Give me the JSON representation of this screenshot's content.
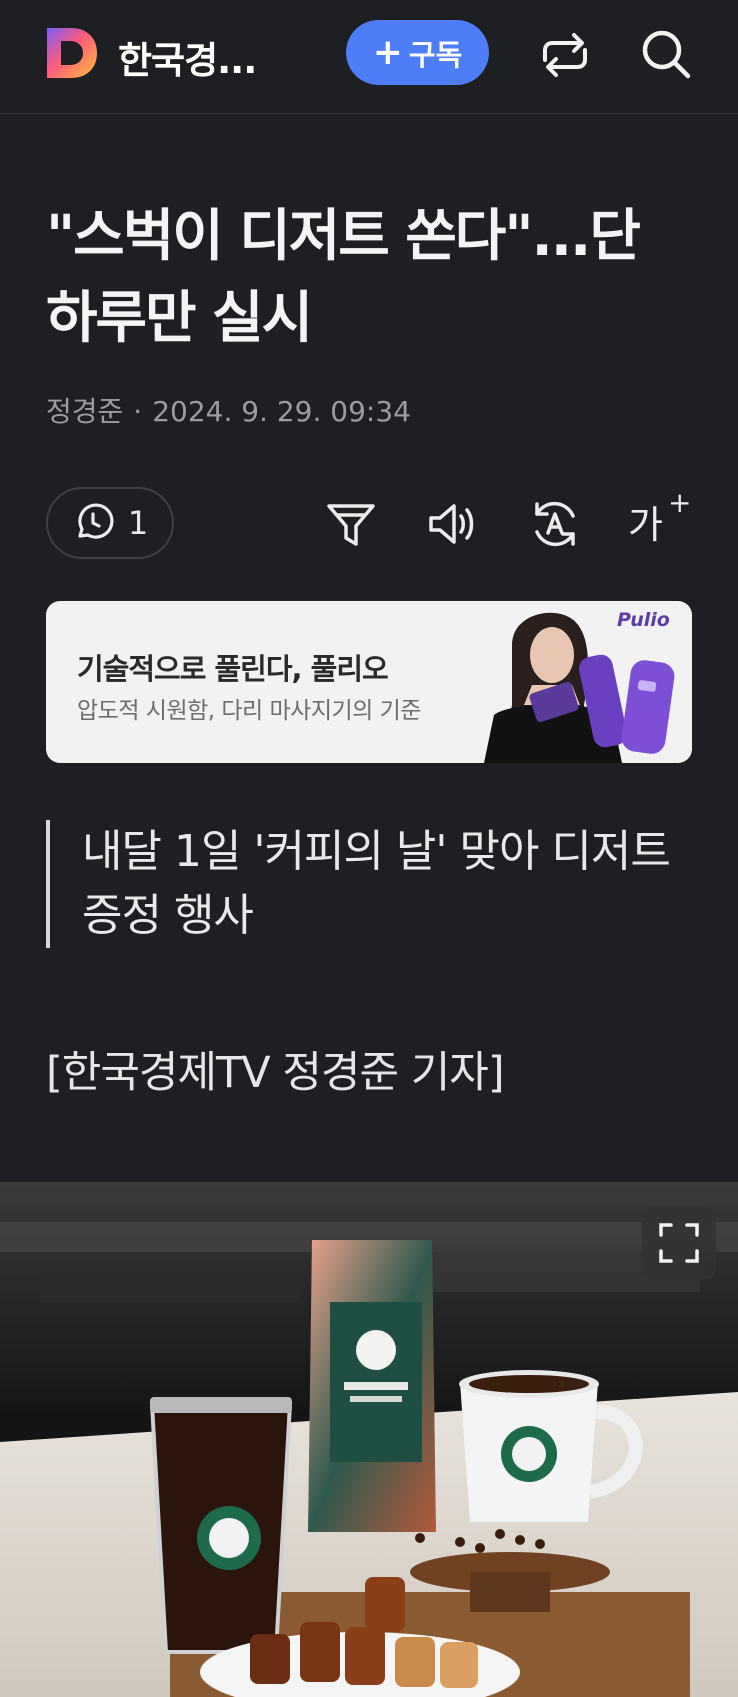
{
  "header": {
    "brand": "한국경...",
    "subscribe_plus": "+",
    "subscribe_label": "구독",
    "icons": [
      "logo-icon",
      "share-icon",
      "search-icon"
    ]
  },
  "article": {
    "title": "\"스벅이 디저트 쏜다\"...단 하루만 실시",
    "author": "정경준",
    "separator": "·",
    "datetime": "2024. 9. 29. 09:34",
    "comment_count": "1",
    "font_size_label": "가",
    "font_size_plus": "+",
    "subheading": "내달 1일 '커피의 날' 맞아 디저트 증정 행사",
    "reporter_line": "[한국경제TV 정경준 기자]"
  },
  "ad": {
    "title": "기술적으로 풀린다, 풀리오",
    "subtitle": "압도적 시원함, 다리 마사지기의 기준",
    "brand": "Pulio"
  },
  "colors": {
    "background": "#1e1f23",
    "accent": "#4d7ef7",
    "text": "#f1f1f3",
    "muted": "#9a9ca3"
  }
}
